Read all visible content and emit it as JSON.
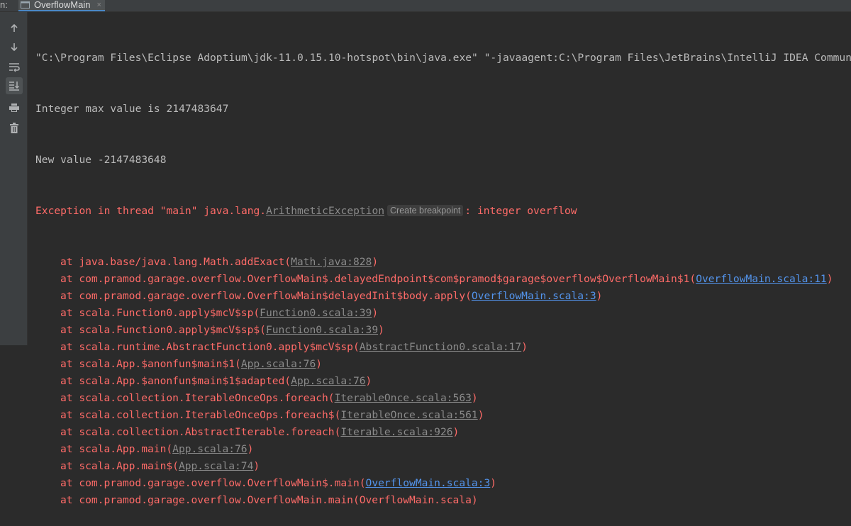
{
  "tabbar": {
    "prefix": "n:",
    "tab_label": "OverflowMain",
    "close_glyph": "×"
  },
  "toolbar": {
    "icons": [
      "up-arrow-icon",
      "down-arrow-icon",
      "soft-wrap-icon",
      "scroll-to-end-icon",
      "print-icon",
      "trash-icon"
    ]
  },
  "console": {
    "command": "\"C:\\Program Files\\Eclipse Adoptium\\jdk-11.0.15.10-hotspot\\bin\\java.exe\" \"-javaagent:C:\\Program Files\\JetBrains\\IntelliJ IDEA Community",
    "output1": "Integer max value is 2147483647",
    "output2": "New value -2147483648",
    "exception": {
      "prefix": "Exception in thread \"main\" java.lang.",
      "class_link": "ArithmeticException",
      "hint": "Create breakpoint",
      "suffix": ": integer overflow"
    },
    "stack": [
      {
        "prefix": "at java.base/java.lang.Math.addExact(",
        "link": "Math.java:828",
        "style": "dim",
        "suffix": ")"
      },
      {
        "prefix": "at com.pramod.garage.overflow.OverflowMain$.delayedEndpoint$com$pramod$garage$overflow$OverflowMain$1(",
        "link": "OverflowMain.scala:11",
        "style": "blue",
        "suffix": ")"
      },
      {
        "prefix": "at com.pramod.garage.overflow.OverflowMain$delayedInit$body.apply(",
        "link": "OverflowMain.scala:3",
        "style": "blue",
        "suffix": ")"
      },
      {
        "prefix": "at scala.Function0.apply$mcV$sp(",
        "link": "Function0.scala:39",
        "style": "dim",
        "suffix": ")"
      },
      {
        "prefix": "at scala.Function0.apply$mcV$sp$(",
        "link": "Function0.scala:39",
        "style": "dim",
        "suffix": ")"
      },
      {
        "prefix": "at scala.runtime.AbstractFunction0.apply$mcV$sp(",
        "link": "AbstractFunction0.scala:17",
        "style": "dim",
        "suffix": ")"
      },
      {
        "prefix": "at scala.App.$anonfun$main$1(",
        "link": "App.scala:76",
        "style": "dim",
        "suffix": ")"
      },
      {
        "prefix": "at scala.App.$anonfun$main$1$adapted(",
        "link": "App.scala:76",
        "style": "dim",
        "suffix": ")"
      },
      {
        "prefix": "at scala.collection.IterableOnceOps.foreach(",
        "link": "IterableOnce.scala:563",
        "style": "dim",
        "suffix": ")"
      },
      {
        "prefix": "at scala.collection.IterableOnceOps.foreach$(",
        "link": "IterableOnce.scala:561",
        "style": "dim",
        "suffix": ")"
      },
      {
        "prefix": "at scala.collection.AbstractIterable.foreach(",
        "link": "Iterable.scala:926",
        "style": "dim",
        "suffix": ")"
      },
      {
        "prefix": "at scala.App.main(",
        "link": "App.scala:76",
        "style": "dim",
        "suffix": ")"
      },
      {
        "prefix": "at scala.App.main$(",
        "link": "App.scala:74",
        "style": "dim",
        "suffix": ")"
      },
      {
        "prefix": "at com.pramod.garage.overflow.OverflowMain$.main(",
        "link": "OverflowMain.scala:3",
        "style": "blue",
        "suffix": ")"
      },
      {
        "prefix": "at com.pramod.garage.overflow.OverflowMain.main(OverflowMain.scala)",
        "link": "",
        "style": "none",
        "suffix": ""
      }
    ]
  },
  "colors": {
    "background": "#2b2b2b",
    "error_text": "#ff6b68",
    "normal_text": "#bbbbbb",
    "link": "#5394ec"
  }
}
